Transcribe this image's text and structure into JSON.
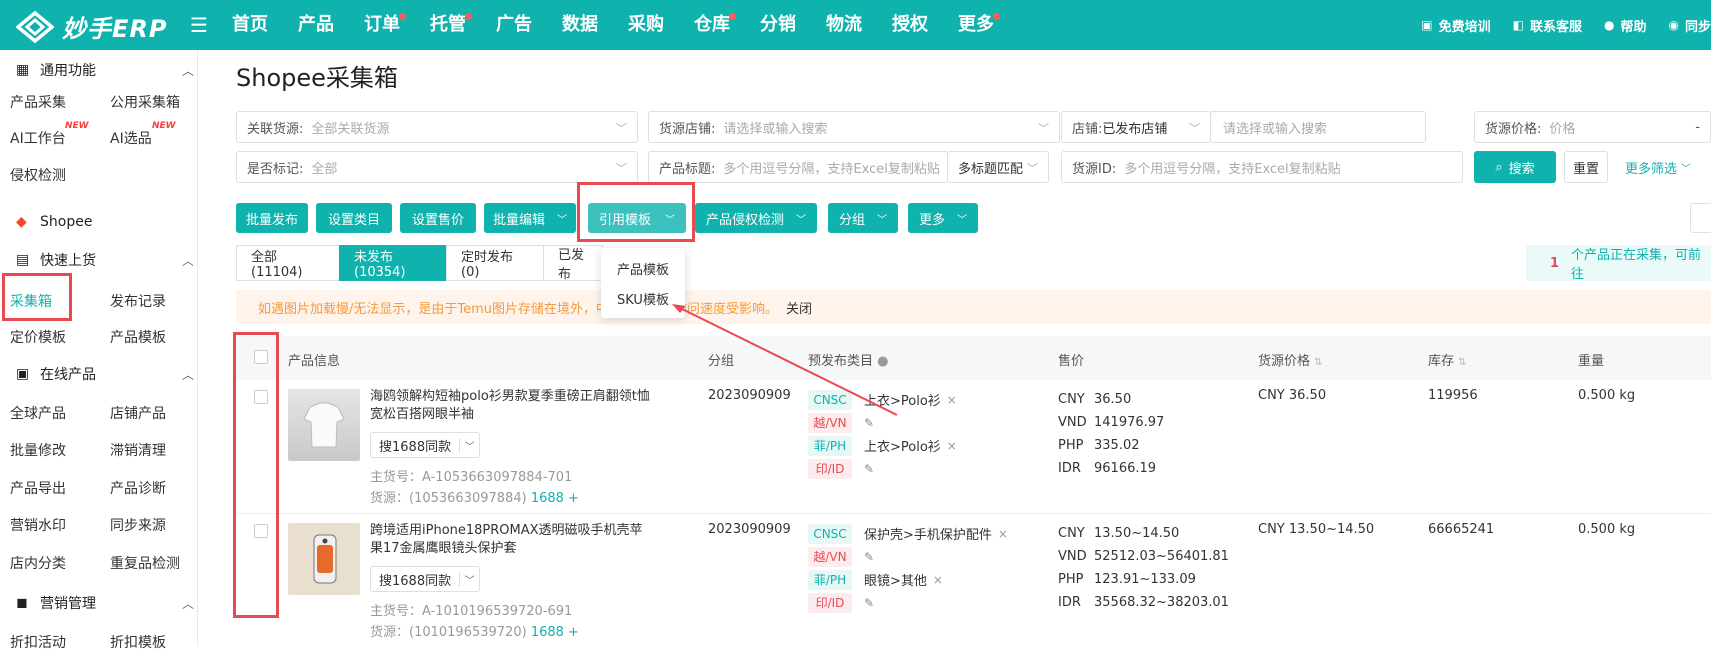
{
  "header": {
    "logo_text": "妙手ERP",
    "nav": [
      {
        "label": "首页",
        "dot": false
      },
      {
        "label": "产品",
        "dot": false
      },
      {
        "label": "订单",
        "dot": true
      },
      {
        "label": "托管",
        "dot": true
      },
      {
        "label": "广告",
        "dot": false
      },
      {
        "label": "数据",
        "dot": false
      },
      {
        "label": "采购",
        "dot": false
      },
      {
        "label": "仓库",
        "dot": true
      },
      {
        "label": "分销",
        "dot": false
      },
      {
        "label": "物流",
        "dot": false
      },
      {
        "label": "授权",
        "dot": false
      },
      {
        "label": "更多",
        "dot": true
      }
    ],
    "right": [
      {
        "icon": "training-icon",
        "label": "免费培训"
      },
      {
        "icon": "service-icon",
        "label": "联系客服"
      },
      {
        "icon": "help-icon",
        "label": "帮助"
      },
      {
        "icon": "sync-icon",
        "label": "同步"
      }
    ]
  },
  "sidebar": {
    "sec_general": "通用功能",
    "item_product_collect": "产品采集",
    "item_public_box": "公用采集箱",
    "item_ai_workbench": "AI工作台",
    "item_ai_select": "AI选品",
    "new_badge": "NEW",
    "item_infringe": "侵权检测",
    "sec_shopee": "Shopee",
    "sec_quick": "快速上货",
    "item_collect_box": "采集箱",
    "item_publish_log": "发布记录",
    "item_price_tpl": "定价模板",
    "item_product_tpl": "产品模板",
    "sec_online": "在线产品",
    "item_global": "全球产品",
    "item_shop_product": "店铺产品",
    "item_batch_edit": "批量修改",
    "item_stale": "滞销清理",
    "item_export": "产品导出",
    "item_diagnose": "产品诊断",
    "item_watermark": "营销水印",
    "item_sync_source": "同步来源",
    "item_shop_category": "店内分类",
    "item_duplicate": "重复品检测",
    "sec_marketing": "营销管理",
    "item_discount": "折扣活动",
    "item_discount_tpl": "折扣模板"
  },
  "page": {
    "title": "Shopee采集箱"
  },
  "filters": {
    "source_label": "关联货源:",
    "source_value": "全部关联货源",
    "source_shop_label": "货源店铺:",
    "source_shop_placeholder": "请选择或输入搜索",
    "shop_label": "店铺:",
    "shop_value": "已发布店铺",
    "shop_placeholder": "请选择或输入搜索",
    "price_label": "货源价格:",
    "price_placeholder": "价格",
    "price_sep": "-",
    "mark_label": "是否标记:",
    "mark_value": "全部",
    "title_label": "产品标题:",
    "title_placeholder": "多个用逗号分隔，支持Excel复制粘贴",
    "title_match": "多标题匹配",
    "source_id_label": "货源ID:",
    "source_id_placeholder": "多个用逗号分隔，支持Excel复制粘贴",
    "search_btn": "搜索",
    "reset_btn": "重置",
    "more_filter": "更多筛选"
  },
  "toolbar": {
    "batch_publish": "批量发布",
    "set_category": "设置类目",
    "set_price": "设置售价",
    "batch_edit": "批量编辑",
    "ref_template": "引用模板",
    "infringe_check": "产品侵权检测",
    "group": "分组",
    "more": "更多"
  },
  "dropdown": {
    "product_tpl": "产品模板",
    "sku_tpl": "SKU模板"
  },
  "tabs": [
    "全部(11104)",
    "未发布(10354)",
    "定时发布(0)",
    "已发布"
  ],
  "collecting": {
    "count": "1",
    "text": "个产品正在采集，可前往"
  },
  "banner": {
    "text": "如遇图片加载慢/无法显示，是由于Temu图片存储在境外，中国大陆网络访问速度受影响。",
    "close": "关闭"
  },
  "table": {
    "headers": {
      "info": "产品信息",
      "group": "分组",
      "category": "预发布类目",
      "price": "售价",
      "source_price": "货源价格",
      "stock": "库存",
      "weight": "重量"
    },
    "rows": [
      {
        "name": "海鸥领解构短袖polo衫男款夏季重磅正肩翻领t恤宽松百搭网眼半袖",
        "same": "搜1688同款",
        "sku": "主货号：A-1053663097884-701",
        "source": "货源：(1053663097884)",
        "source_link": "1688",
        "group": "2023090909",
        "cats": [
          {
            "tag": "CNSC",
            "text": "上衣>Polo衫"
          },
          {
            "tag": "越/VN",
            "text": ""
          },
          {
            "tag": "菲/PH",
            "text": "上衣>Polo衫"
          },
          {
            "tag": "印/ID",
            "text": ""
          }
        ],
        "prices": [
          {
            "cur": "CNY",
            "val": "36.50"
          },
          {
            "cur": "VND",
            "val": "141976.97"
          },
          {
            "cur": "PHP",
            "val": "335.02"
          },
          {
            "cur": "IDR",
            "val": "96166.19"
          }
        ],
        "source_price": "CNY 36.50",
        "stock": "119956",
        "weight": "0.500 kg"
      },
      {
        "name": "跨境适用iPhone18PROMAX透明磁吸手机壳苹果17金属鹰眼镜头保护套",
        "same": "搜1688同款",
        "sku": "主货号：A-1010196539720-691",
        "source": "货源：(1010196539720)",
        "source_link": "1688",
        "group": "2023090909",
        "cats": [
          {
            "tag": "CNSC",
            "text": "保护壳>手机保护配件"
          },
          {
            "tag": "越/VN",
            "text": ""
          },
          {
            "tag": "菲/PH",
            "text": "眼镜>其他"
          },
          {
            "tag": "印/ID",
            "text": ""
          }
        ],
        "prices": [
          {
            "cur": "CNY",
            "val": "13.50~14.50"
          },
          {
            "cur": "VND",
            "val": "52512.03~56401.81"
          },
          {
            "cur": "PHP",
            "val": "123.91~133.09"
          },
          {
            "cur": "IDR",
            "val": "35568.32~38203.01"
          }
        ],
        "source_price": "CNY 13.50~14.50",
        "stock": "66665241",
        "weight": "0.500 kg"
      }
    ]
  },
  "colors": {
    "brand": "#10b2ae",
    "highlight": "#e84a52",
    "warning": "#f39a3f"
  }
}
